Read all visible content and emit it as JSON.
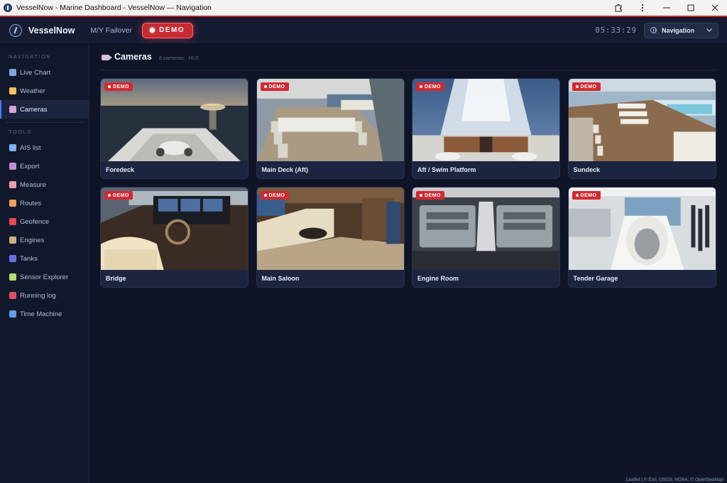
{
  "window": {
    "title": "VesselNow - Marine Dashboard - VesselNow — Navigation"
  },
  "header": {
    "brand": "VesselNow",
    "vessel": "M/Y Failover",
    "demo_label": "DEMO",
    "clock": "05:33:29",
    "nav_select": "Navigation"
  },
  "sidebar": {
    "nav_heading": "NAVIGATION",
    "nav_items": [
      {
        "label": "Live Chart",
        "icon": "chart-icon",
        "color": "#7fa7e8"
      },
      {
        "label": "Weather",
        "icon": "weather-icon",
        "color": "#f3c25a"
      },
      {
        "label": "Cameras",
        "icon": "camera-icon",
        "color": "#d4a6d8",
        "active": true
      }
    ],
    "tools_heading": "TOOLS",
    "tool_items": [
      {
        "label": "AIS list",
        "icon": "anchor-icon",
        "color": "#7fb0ff"
      },
      {
        "label": "Export",
        "icon": "export-icon",
        "color": "#c58bd6"
      },
      {
        "label": "Measure",
        "icon": "ruler-icon",
        "color": "#e8a0b0"
      },
      {
        "label": "Routes",
        "icon": "routes-icon",
        "color": "#f0a060"
      },
      {
        "label": "Geofence",
        "icon": "geofence-icon",
        "color": "#e84850"
      },
      {
        "label": "Engines",
        "icon": "engine-icon",
        "color": "#d0b080"
      },
      {
        "label": "Tanks",
        "icon": "tank-icon",
        "color": "#6a70e0"
      },
      {
        "label": "Sensor Explorer",
        "icon": "sensor-icon",
        "color": "#b8e070"
      },
      {
        "label": "Running log",
        "icon": "pin-icon",
        "color": "#e05060"
      },
      {
        "label": "Time Machine",
        "icon": "time-icon",
        "color": "#60a0e8"
      }
    ]
  },
  "page": {
    "title": "Cameras",
    "subtitle": "8 cameras · HLS"
  },
  "badge_label": "DEMO",
  "cameras": [
    {
      "name": "Foredeck",
      "scene": "foredeck"
    },
    {
      "name": "Main Deck (Aft)",
      "scene": "maindeck"
    },
    {
      "name": "Aft / Swim Platform",
      "scene": "aft"
    },
    {
      "name": "Sundeck",
      "scene": "sundeck"
    },
    {
      "name": "Bridge",
      "scene": "bridge"
    },
    {
      "name": "Main Saloon",
      "scene": "saloon"
    },
    {
      "name": "Engine Room",
      "scene": "engine"
    },
    {
      "name": "Tender Garage",
      "scene": "garage"
    }
  ],
  "attribution": "Leaflet | © Esri, USGS, NOAA, © OpenSeaMap",
  "colors": {
    "accent_red": "#d22a33",
    "accent_blue": "#4a7cff",
    "background": "#0f1426"
  }
}
